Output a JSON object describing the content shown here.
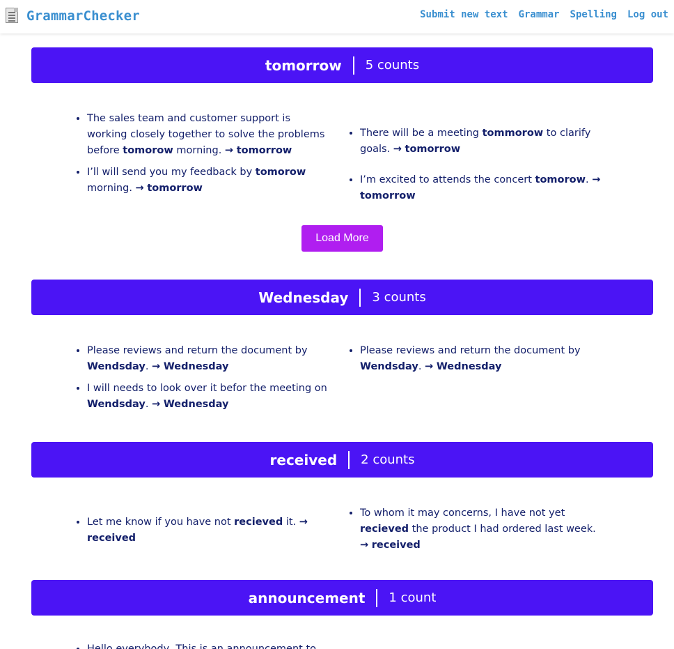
{
  "app": {
    "name": "GrammarChecker",
    "logo_icon": "document-icon"
  },
  "nav": {
    "links": [
      {
        "label": "Submit new text"
      },
      {
        "label": "Grammar"
      },
      {
        "label": "Spelling"
      },
      {
        "label": "Log out"
      }
    ]
  },
  "colors": {
    "header_bg": "#4b14f5",
    "button_bg": "#b01ef0",
    "link": "#3a8fd0",
    "text": "#14206b"
  },
  "arrow": "→",
  "sections": [
    {
      "word": "tomorrow",
      "count": "5 counts",
      "load_more": "Load More",
      "left": [
        {
          "before": "The sales team and customer support is working closely together to solve the problems before ",
          "error": "tomorow",
          "after": " morning. ",
          "fix": "tomorrow"
        },
        {
          "before": "I’ll will send you my feedback by ",
          "error": "tomorow",
          "after": " morning. ",
          "fix": "tomorrow"
        }
      ],
      "right": [
        {
          "before": "There will be a meeting ",
          "error": "tommorow",
          "after": " to clarify goals. ",
          "fix": "tomorrow"
        },
        {
          "before": "I’m excited to attends the concert ",
          "error": "tomorow",
          "after": ". ",
          "fix": "tomorrow"
        }
      ]
    },
    {
      "word": "Wednesday",
      "count": "3 counts",
      "left": [
        {
          "before": "Please reviews and return the document by ",
          "error": "Wendsday",
          "after": ". ",
          "fix": "Wednesday"
        },
        {
          "before": "I will needs to look over it befor the meeting on ",
          "error": "Wendsday",
          "after": ". ",
          "fix": "Wednesday"
        }
      ],
      "right": [
        {
          "before": "Please reviews and return the document by ",
          "error": "Wendsday",
          "after": ". ",
          "fix": "Wednesday"
        }
      ]
    },
    {
      "word": "received",
      "count": "2 counts",
      "left": [
        {
          "before": "Let me know if you have not ",
          "error": "recieved",
          "after": " it. ",
          "fix": "received"
        }
      ],
      "right": [
        {
          "before": "To whom it may concerns, I have not yet ",
          "error": "recieved",
          "after": " the product I had ordered last week. ",
          "fix": "received"
        }
      ]
    },
    {
      "word": "announcement",
      "count": "1 count",
      "left": [
        {
          "partial": "Hello everybody, This is an announcement to"
        }
      ]
    }
  ]
}
